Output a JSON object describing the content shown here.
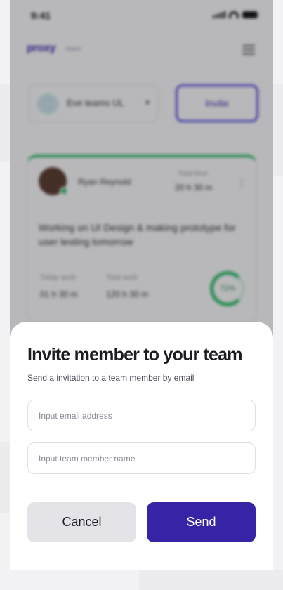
{
  "status_bar": {
    "time": "9:41"
  },
  "app": {
    "logo": "proxy",
    "logo_tag": "teams"
  },
  "team_selector": {
    "name": "Eve teams UL"
  },
  "invite_button": {
    "label": "Invite"
  },
  "member_card": {
    "name": "Ryan Reynold",
    "time_label": "Total time",
    "time_value": "20 h 30 m",
    "task": "Working on UI Design & making prototype for user testing tomorrow",
    "stats": [
      {
        "label": "Today work",
        "value": "01 h 30 m"
      },
      {
        "label": "Total work",
        "value": "120 h 30 m"
      }
    ],
    "progress_label": "72%",
    "progress": 0.72
  },
  "modal": {
    "title": "Invite member to your team",
    "subtitle": "Send a invitation to a team member by email",
    "email_placeholder": "Input email address",
    "name_placeholder": "Input team member name",
    "cancel_label": "Cancel",
    "send_label": "Send"
  },
  "colors": {
    "primary": "#3524a6",
    "accent_green": "#2fbf6b",
    "cancel_bg": "#e4e4e8"
  }
}
